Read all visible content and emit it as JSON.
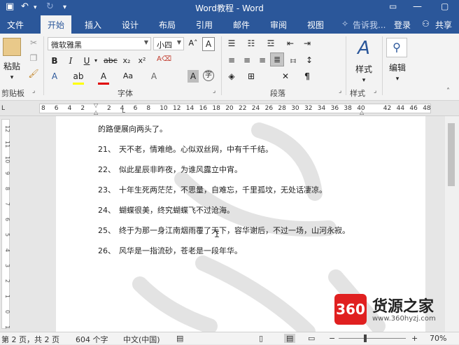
{
  "window": {
    "title": "Word教程 - Word"
  },
  "tabs": {
    "file": "文件",
    "home": "开始",
    "insert": "插入",
    "design": "设计",
    "layout": "布局",
    "references": "引用",
    "mailings": "邮件",
    "review": "审阅",
    "view": "视图",
    "tell_me": "告诉我...",
    "sign_in": "登录",
    "share": "共享"
  },
  "ribbon": {
    "paste_label": "粘贴",
    "clipboard_label": "剪贴板",
    "font_name": "微软雅黑",
    "font_size": "小四",
    "font_group_label": "字体",
    "paragraph_group_label": "段落",
    "styles_label": "样式",
    "styles_group_label": "样式",
    "editing_label": "编辑"
  },
  "ruler": {
    "numbers": [
      "8",
      "6",
      "4",
      "2",
      "",
      "2",
      "4",
      "6",
      "8",
      "10",
      "12",
      "14",
      "16",
      "18",
      "20",
      "22",
      "24",
      "26",
      "28",
      "30",
      "32",
      "34",
      "36",
      "38",
      "40",
      "",
      "42",
      "44",
      "46",
      "48"
    ]
  },
  "vruler": {
    "numbers": [
      "12",
      "11",
      "10",
      "9",
      "8",
      "7",
      "6",
      "5",
      "4",
      "3",
      "2",
      "1",
      "0",
      "1"
    ]
  },
  "document": {
    "lines": [
      {
        "num": "",
        "text": "的路便展向两头了。"
      },
      {
        "num": "21、",
        "text": "天不老，情难绝。心似双丝网，中有千千结。"
      },
      {
        "num": "22、",
        "text": "似此星辰非昨夜，为谁风露立中宵。"
      },
      {
        "num": "23、",
        "text": "十年生死两茫茫，不思量，自难忘，千里孤坟，无处话凄凉。"
      },
      {
        "num": "24、",
        "text": "蝴蝶很美，终究蝴蝶飞不过沧海。"
      },
      {
        "num": "25、",
        "text": "终于为那一身江南烟雨覆了天下，容华谢后，不过一场，山河永寂。"
      },
      {
        "num": "26、",
        "text": "风华是一指流砂，苍老是一段年华。"
      }
    ]
  },
  "statusbar": {
    "page": "第 2 页，共 2 页",
    "words": "604 个字",
    "language": "中文(中国)",
    "zoom": "70%"
  },
  "watermark": {
    "logo": "360",
    "name": "货源之家",
    "url": "www.360hyzj.com"
  }
}
